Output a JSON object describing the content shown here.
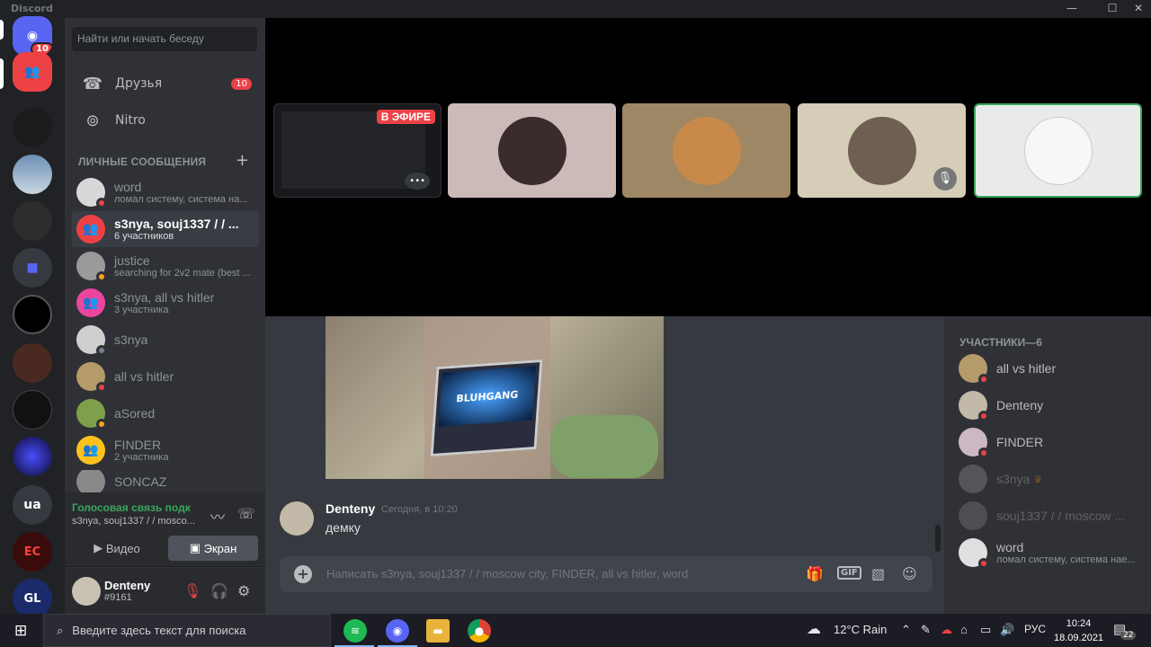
{
  "window": {
    "app_name": "Discord",
    "minimize": "—",
    "maximize": "☐",
    "close": "✕"
  },
  "rail": {
    "home_badge": "10",
    "server_ua": "ua",
    "server_ec": "EC",
    "server_gl": "GL"
  },
  "sidebar": {
    "search_placeholder": "Найти или начать беседу",
    "friends_label": "Друзья",
    "friends_count": "10",
    "nitro_label": "Nitro",
    "dm_header": "ЛИЧНЫЕ СООБЩЕНИЯ",
    "dm_add": "+",
    "dms": [
      {
        "name": "word",
        "sub": "ломал систему, система на..."
      },
      {
        "name": "s3nya, souj1337 / / ...",
        "sub": "6 участников"
      },
      {
        "name": "justice",
        "sub": "searching for 2v2 mate (best ..."
      },
      {
        "name": "s3nya, all vs hitler",
        "sub": "3 участника"
      },
      {
        "name": "s3nya",
        "sub": ""
      },
      {
        "name": "all vs hitler",
        "sub": ""
      },
      {
        "name": "aSored",
        "sub": ""
      },
      {
        "name": "FINDER",
        "sub": "2 участника"
      },
      {
        "name": "SONCAZ",
        "sub": ""
      }
    ]
  },
  "voice": {
    "status": "Голосовая связь подк",
    "channel": "s3nya, souj1337 / / mosco...",
    "video_label": "Видео",
    "screen_label": "Экран"
  },
  "user": {
    "name": "Denteny",
    "tag": "#9161"
  },
  "stage": {
    "live_label": "В ЭФИРЕ",
    "more": "•••"
  },
  "message": {
    "author": "Denteny",
    "time": "Сегодня, в 10:20",
    "text": "демку",
    "laptop_text": "BLUHGANG"
  },
  "composer": {
    "placeholder": "Написать s3nya, souj1337 / / moscow city, FINDER, all vs hitler, word",
    "gif": "GIF"
  },
  "members": {
    "header": "УЧАСТНИКИ—6",
    "list": [
      {
        "name": "all vs hitler",
        "sub": ""
      },
      {
        "name": "Denteny",
        "sub": ""
      },
      {
        "name": "FINDER",
        "sub": ""
      },
      {
        "name": "s3nya",
        "sub": ""
      },
      {
        "name": "souj1337 / / moscow ...",
        "sub": ""
      },
      {
        "name": "word",
        "sub": "ломал систему, система нае..."
      }
    ]
  },
  "taskbar": {
    "search_placeholder": "Введите здесь текст для поиска",
    "weather": "12°C  Rain",
    "lang": "РУС",
    "time": "10:24",
    "date": "18.09.2021",
    "notif_count": "22"
  }
}
